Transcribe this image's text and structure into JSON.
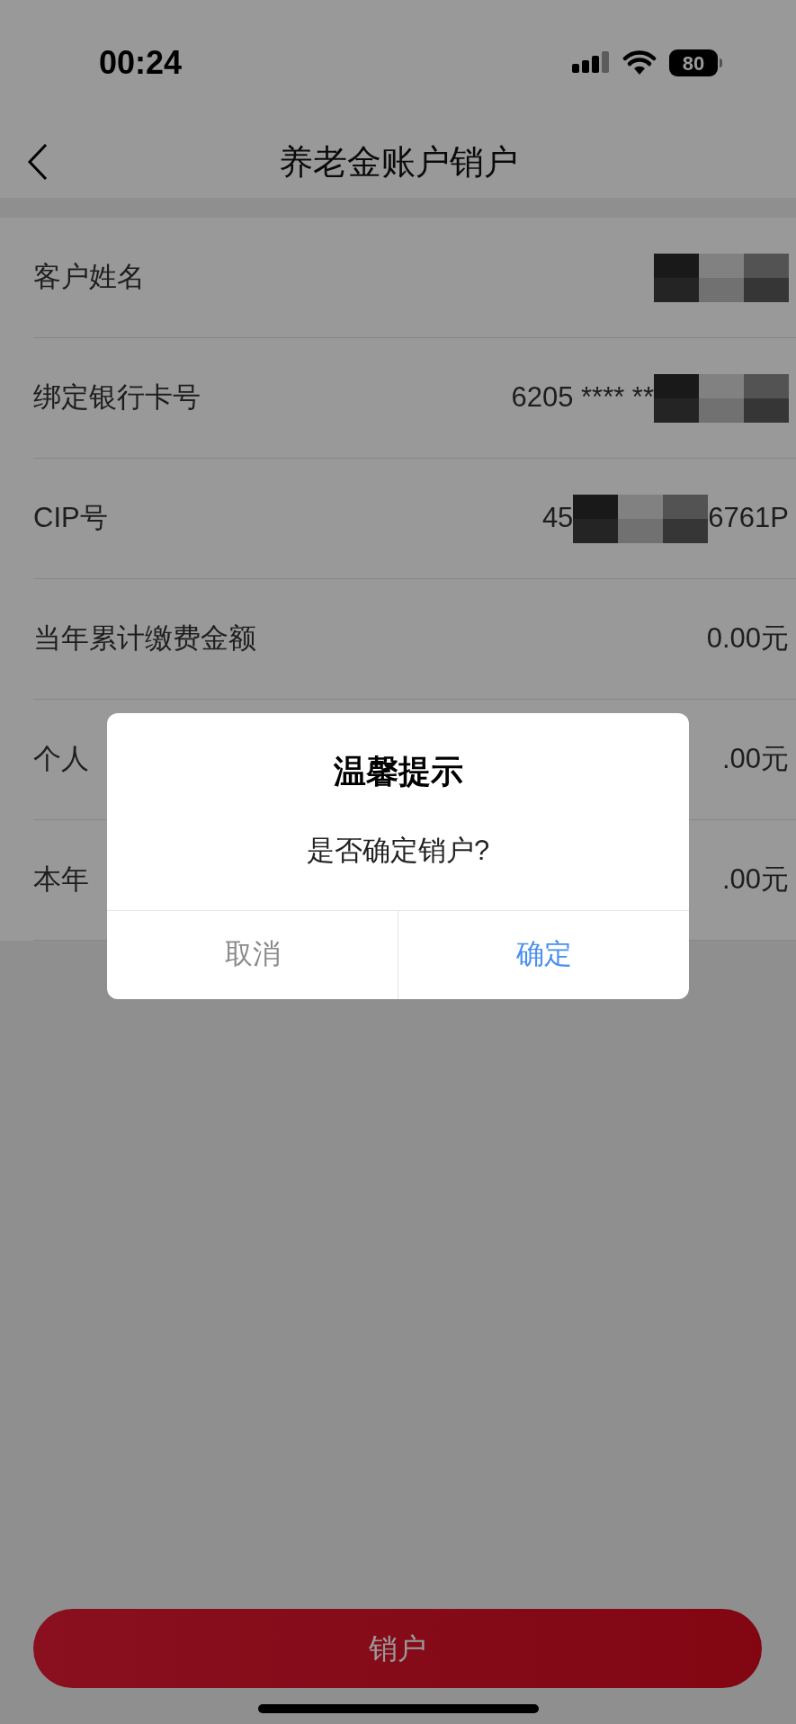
{
  "status_bar": {
    "time": "00:24",
    "battery": "80"
  },
  "nav": {
    "title": "养老金账户销户"
  },
  "rows": [
    {
      "label": "客户姓名",
      "value_parts": [
        {
          "kind": "redaction"
        }
      ]
    },
    {
      "label": "绑定银行卡号",
      "value_parts": [
        {
          "kind": "text",
          "text": "6205 **** **"
        },
        {
          "kind": "redaction"
        }
      ]
    },
    {
      "label": "CIP号",
      "value_parts": [
        {
          "kind": "text",
          "text": "45"
        },
        {
          "kind": "redaction"
        },
        {
          "kind": "text",
          "text": "6761P"
        }
      ]
    },
    {
      "label": "当年累计缴费金额",
      "value_parts": [
        {
          "kind": "text",
          "text": "0.00元"
        }
      ]
    },
    {
      "label": "个人",
      "value_parts": [
        {
          "kind": "text",
          "text": ".00元"
        }
      ]
    },
    {
      "label": "本年",
      "value_parts": [
        {
          "kind": "text",
          "text": ".00元"
        }
      ]
    }
  ],
  "dialog": {
    "title": "温馨提示",
    "message": "是否确定销户?",
    "buttons": [
      {
        "label": "取消",
        "kind": "cancel"
      },
      {
        "label": "确定",
        "kind": "confirm"
      }
    ]
  },
  "bottom_button": {
    "label": "销户"
  }
}
